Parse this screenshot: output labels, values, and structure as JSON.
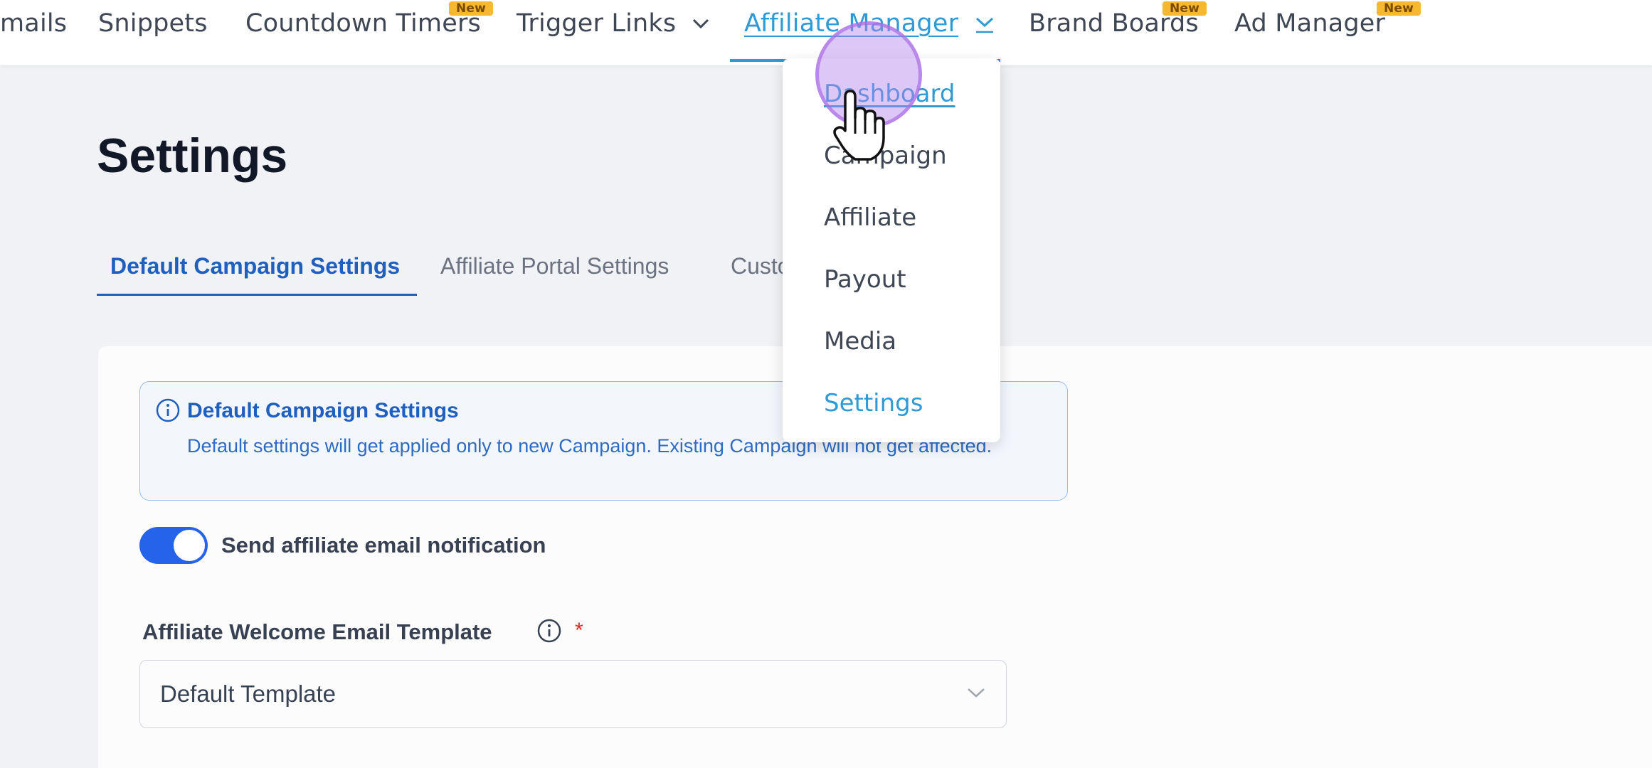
{
  "nav": {
    "items": [
      {
        "label": "mails"
      },
      {
        "label": "Snippets"
      },
      {
        "label": "Countdown Timers",
        "badge": "New"
      },
      {
        "label": "Trigger Links"
      },
      {
        "label": "Affiliate Manager"
      },
      {
        "label": "Brand Boards",
        "badge": "New"
      },
      {
        "label": "Ad Manager",
        "badge": "New"
      }
    ],
    "active_color": "#2e9bd6"
  },
  "dropdown": {
    "items": [
      "Dashboard",
      "Campaign",
      "Affiliate",
      "Payout",
      "Media",
      "Settings"
    ],
    "hovered": "Dashboard"
  },
  "page": {
    "title": "Settings",
    "tabs": [
      "Default Campaign Settings",
      "Affiliate Portal Settings",
      "Custo"
    ],
    "active_tab": "Default Campaign Settings"
  },
  "alert": {
    "title": "Default Campaign Settings",
    "body": "Default settings will get applied only to new Campaign. Existing Campaign will not get affected.",
    "icon": "info-icon"
  },
  "notification_toggle": {
    "label": "Send affiliate email notification",
    "on": true
  },
  "welcome_template": {
    "label": "Affiliate Welcome Email Template",
    "required_mark": "*",
    "value": "Default Template"
  },
  "colors": {
    "primary": "#2563eb",
    "link": "#2e9bd6",
    "badge": "#f5b82e",
    "required": "#dc2626"
  }
}
